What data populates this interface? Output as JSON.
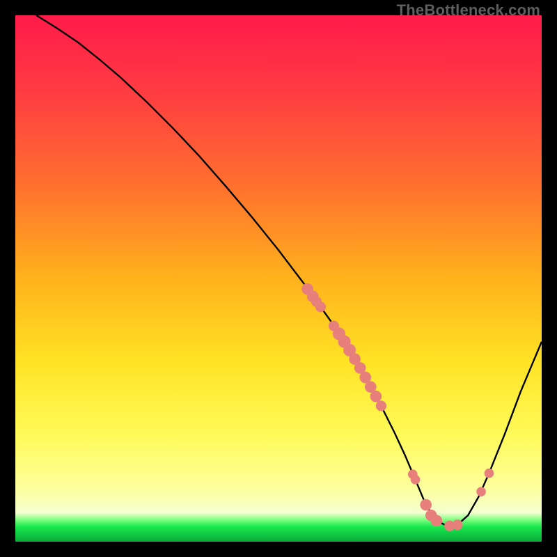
{
  "watermark": "TheBottleneck.com",
  "colors": {
    "bg": "#000000",
    "curve": "#000000",
    "marker": "#e77f7b",
    "watermark": "#5f5f5f"
  },
  "chart_data": {
    "type": "line",
    "title": "",
    "xlabel": "",
    "ylabel": "",
    "xlim": [
      0,
      100
    ],
    "ylim": [
      0,
      100
    ],
    "grid": false,
    "legend": false,
    "notes": "Background is a red→yellow→green top-to-bottom gradient with a thin bright green band near the bottom. A single black curve descends from top-left, reaches a minimum near x≈78, then rises toward the right edge. Salmon-colored circular markers sit on the curve roughly between x≈55 and x≈90.",
    "gradient_stops": [
      {
        "offset": 0.0,
        "color": "#ff1b4a"
      },
      {
        "offset": 0.15,
        "color": "#ff3d42"
      },
      {
        "offset": 0.32,
        "color": "#ff6f2e"
      },
      {
        "offset": 0.5,
        "color": "#ffb21c"
      },
      {
        "offset": 0.66,
        "color": "#ffe325"
      },
      {
        "offset": 0.8,
        "color": "#fffb5a"
      },
      {
        "offset": 0.9,
        "color": "#fdff9e"
      },
      {
        "offset": 0.945,
        "color": "#f4ffd0"
      },
      {
        "offset": 0.958,
        "color": "#80ff80"
      },
      {
        "offset": 0.972,
        "color": "#18e84e"
      },
      {
        "offset": 1.0,
        "color": "#0aa838"
      }
    ],
    "series": [
      {
        "name": "curve",
        "x": [
          4,
          8,
          12,
          16,
          20,
          25,
          30,
          35,
          40,
          45,
          50,
          55,
          58,
          60,
          62,
          64,
          66,
          68,
          70,
          72,
          74,
          76,
          78,
          80,
          82,
          84,
          86,
          88,
          90,
          93,
          96,
          100
        ],
        "y": [
          100,
          97.5,
          94.8,
          91.6,
          88.2,
          83.5,
          78.5,
          73.2,
          67.5,
          61.6,
          55.4,
          48.8,
          44.6,
          41.8,
          38.8,
          35.6,
          32.2,
          28.6,
          24.8,
          20.8,
          16.5,
          11.8,
          7.0,
          4.0,
          3.0,
          3.2,
          5.0,
          8.5,
          13.0,
          20.5,
          28.5,
          38.0
        ]
      }
    ],
    "markers": [
      {
        "x": 55.5,
        "y": 48.0,
        "r": 1.1
      },
      {
        "x": 56.5,
        "y": 46.6,
        "r": 1.1
      },
      {
        "x": 57.2,
        "y": 45.6,
        "r": 1.0
      },
      {
        "x": 58.0,
        "y": 44.6,
        "r": 1.0
      },
      {
        "x": 60.5,
        "y": 41.0,
        "r": 1.0
      },
      {
        "x": 61.5,
        "y": 39.5,
        "r": 1.2
      },
      {
        "x": 62.5,
        "y": 38.0,
        "r": 1.2
      },
      {
        "x": 63.5,
        "y": 36.4,
        "r": 1.2
      },
      {
        "x": 64.5,
        "y": 34.7,
        "r": 1.1
      },
      {
        "x": 65.5,
        "y": 33.0,
        "r": 1.1
      },
      {
        "x": 66.5,
        "y": 31.2,
        "r": 1.1
      },
      {
        "x": 67.5,
        "y": 29.4,
        "r": 1.1
      },
      {
        "x": 68.5,
        "y": 27.6,
        "r": 1.1
      },
      {
        "x": 69.5,
        "y": 25.8,
        "r": 1.0
      },
      {
        "x": 75.5,
        "y": 12.8,
        "r": 0.9
      },
      {
        "x": 76.0,
        "y": 11.8,
        "r": 0.9
      },
      {
        "x": 78.0,
        "y": 7.0,
        "r": 1.1
      },
      {
        "x": 79.0,
        "y": 5.0,
        "r": 1.1
      },
      {
        "x": 80.0,
        "y": 4.0,
        "r": 1.1
      },
      {
        "x": 82.5,
        "y": 3.0,
        "r": 1.0
      },
      {
        "x": 84.0,
        "y": 3.2,
        "r": 1.0
      },
      {
        "x": 88.5,
        "y": 9.5,
        "r": 0.9
      },
      {
        "x": 90.0,
        "y": 13.0,
        "r": 0.9
      }
    ]
  }
}
